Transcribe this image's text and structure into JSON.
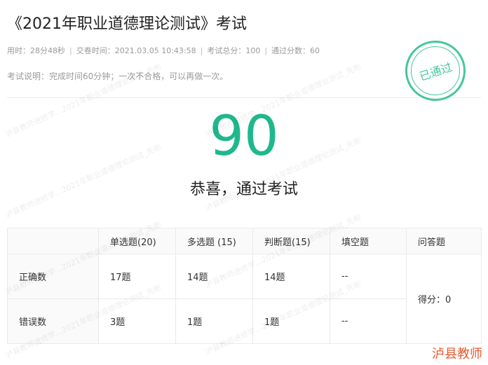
{
  "exam": {
    "title": "《2021年职业道德理论测试》考试",
    "duration": "用时：28分48秒",
    "submit_time": "交卷时间：2021.03.05 10:43:58",
    "total_score": "考试总分：100",
    "pass_score": "通过分数：60",
    "description": "考试说明：完成时间60分钟；一次不合格，可以再做一次。"
  },
  "stamp": {
    "label": "已通过",
    "color": "#45c79a"
  },
  "result": {
    "score": "90",
    "message": "恭喜，通过考试",
    "score_color": "#1fb88d"
  },
  "table": {
    "headers": [
      "",
      "单选题(20)",
      "多选题 (15)",
      "判断题(15)",
      "填空题",
      "问答题"
    ],
    "rows": [
      {
        "label": "正确数",
        "cells": [
          "17题",
          "14题",
          "14题",
          "--"
        ]
      },
      {
        "label": "错误数",
        "cells": [
          "3题",
          "1题",
          "1题",
          "--"
        ]
      }
    ],
    "essay_score": "得分：0"
  },
  "watermark": {
    "text": "泸县教师进修学...2021年职业道德理论测试_先彬"
  },
  "corner_logo": "泸县教师"
}
